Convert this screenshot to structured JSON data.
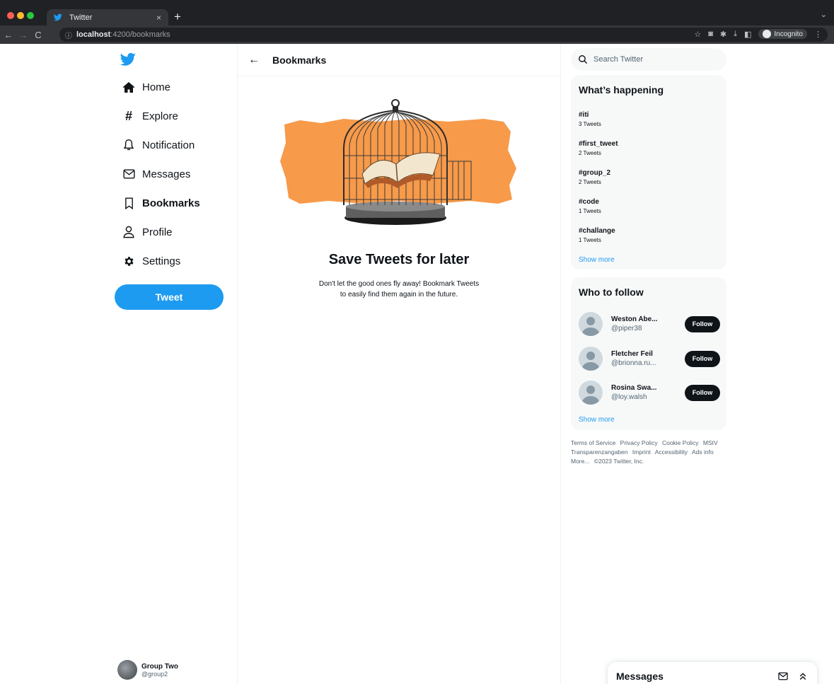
{
  "browser": {
    "tab_title": "Twitter",
    "tab_close": "×",
    "new_tab": "+",
    "url_host": "localhost",
    "url_path": ":4200/bookmarks",
    "profile_label": "Incognito"
  },
  "sidebar": {
    "items": [
      {
        "label": "Home",
        "icon": "home-icon"
      },
      {
        "label": "Explore",
        "icon": "hashtag-icon"
      },
      {
        "label": "Notification",
        "icon": "bell-icon"
      },
      {
        "label": "Messages",
        "icon": "envelope-icon"
      },
      {
        "label": "Bookmarks",
        "icon": "bookmark-icon",
        "active": true
      },
      {
        "label": "Profile",
        "icon": "user-icon"
      },
      {
        "label": "Settings",
        "icon": "gear-icon"
      }
    ],
    "tweet_button": "Tweet",
    "account": {
      "name": "Group Two",
      "handle": "@group2"
    }
  },
  "main": {
    "title": "Bookmarks",
    "empty_title": "Save Tweets for later",
    "empty_desc": "Don't let the good ones fly away! Bookmark Tweets to easily find them again in the future."
  },
  "right": {
    "search_placeholder": "Search Twitter",
    "happening": {
      "title": "What’s happening",
      "trends": [
        {
          "tag": "#iti",
          "count": "3 Tweets"
        },
        {
          "tag": "#first_tweet",
          "count": "2 Tweets"
        },
        {
          "tag": "#group_2",
          "count": "2 Tweets"
        },
        {
          "tag": "#code",
          "count": "1 Tweets"
        },
        {
          "tag": "#challange",
          "count": "1 Tweets"
        }
      ],
      "show_more": "Show more"
    },
    "who_to_follow": {
      "title": "Who to follow",
      "users": [
        {
          "name": "Weston Abe...",
          "handle": "@piper38",
          "button": "Follow"
        },
        {
          "name": "Fletcher Feil",
          "handle": "@brionna.ru...",
          "button": "Follow"
        },
        {
          "name": "Rosina Swa...",
          "handle": "@loy.walsh",
          "button": "Follow"
        }
      ],
      "show_more": "Show more"
    },
    "footer": {
      "links": [
        "Terms of Service",
        "Privacy Policy",
        "Cookie Policy",
        "MStV Transparenzangaben",
        "Imprint",
        "Accessibility",
        "Ads info",
        "More...",
        "©2023 Twitter, Inc."
      ]
    }
  },
  "messages_drawer": {
    "title": "Messages"
  },
  "colors": {
    "accent": "#1d9bf0",
    "illustration_orange": "#f79a4a",
    "dark": "#0f1419"
  }
}
